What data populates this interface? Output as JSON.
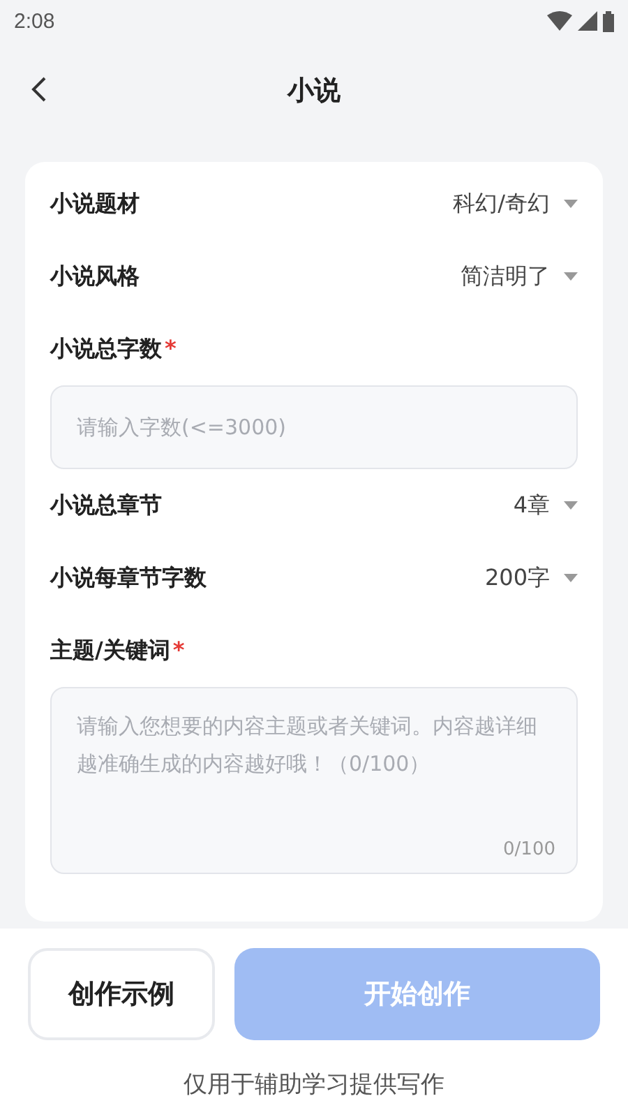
{
  "status_bar": {
    "time": "2:08"
  },
  "header": {
    "title": "小说"
  },
  "form": [
    {
      "kind": "picker",
      "label": "小说题材",
      "value": "科幻/奇幻"
    },
    {
      "kind": "picker",
      "label": "小说风格",
      "value": "简洁明了"
    },
    {
      "kind": "input",
      "label": "小说总字数",
      "required": true,
      "required_mark": "*",
      "placeholder": "请输入字数(<=3000)"
    },
    {
      "kind": "picker",
      "label": "小说总章节",
      "value": "4章"
    },
    {
      "kind": "picker",
      "label": "小说每章节字数",
      "value": "200字"
    },
    {
      "kind": "textarea",
      "label": "主题/关键词",
      "required": true,
      "required_mark": "*",
      "placeholder": "请输入您想要的内容主题或者关键词。内容越详细越准确生成的内容越好哦！（0/100）",
      "counter": "0/100"
    }
  ],
  "buttons": [
    {
      "kind": "secondary",
      "label": "创作示例",
      "disabled": false
    },
    {
      "kind": "primary",
      "label": "开始创作",
      "disabled": true
    }
  ],
  "footer_note": "仅用于辅助学习提供写作"
}
